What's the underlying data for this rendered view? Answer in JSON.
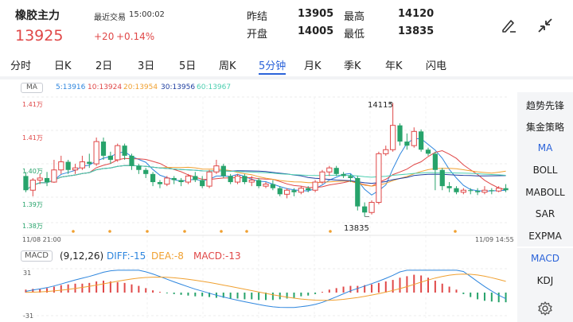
{
  "header": {
    "symbol": "橡胶主力",
    "last_trade_label": "最近交易",
    "last_trade_time": "15:00:02",
    "price": "13925",
    "change": "+20",
    "change_pct": "+0.14%",
    "prev_close_label": "昨结",
    "prev_close": "13905",
    "open_label": "开盘",
    "open": "14005",
    "high_label": "最高",
    "high": "14120",
    "low_label": "最低",
    "low": "13835",
    "icons": [
      "draw-pen-icon",
      "collapse-arrows-icon"
    ]
  },
  "tabs": [
    {
      "label": "分时"
    },
    {
      "label": "日K"
    },
    {
      "label": "2日"
    },
    {
      "label": "3日"
    },
    {
      "label": "5日"
    },
    {
      "label": "周K"
    },
    {
      "label": "5分钟",
      "active": true
    },
    {
      "label": "月K"
    },
    {
      "label": "季K"
    },
    {
      "label": "年K"
    },
    {
      "label": "闪电"
    }
  ],
  "ma_legend": {
    "badge": "MA",
    "items": [
      {
        "label": "5:13916",
        "color": "#2e86de"
      },
      {
        "label": "10:13924",
        "color": "#e04848"
      },
      {
        "label": "20:13954",
        "color": "#f0a030"
      },
      {
        "label": "30:13956",
        "color": "#1f3fa0"
      },
      {
        "label": "60:13967",
        "color": "#4ccfb0"
      }
    ]
  },
  "price_axis": {
    "labels": [
      "1.41万",
      "1.41万",
      "1.40万",
      "1.39万",
      "1.38万"
    ]
  },
  "time_axis": {
    "start": "11/08 21:00",
    "end": "11/09 14:55"
  },
  "markers": {
    "high": "14115",
    "low": "13835"
  },
  "macd_legend": {
    "badge": "MACD",
    "params": "(9,12,26)",
    "diff": "DIFF:-15",
    "dea": "DEA:-8",
    "macd": "MACD:-13",
    "axis_top": "31",
    "axis_bottom": "-31"
  },
  "sidebar": {
    "items": [
      {
        "label": "趋势先锋"
      },
      {
        "label": "集金策略"
      },
      {
        "label": "MA",
        "active": true
      },
      {
        "label": "BOLL"
      },
      {
        "label": "MABOLL"
      },
      {
        "label": "SAR"
      },
      {
        "label": "EXPMA"
      },
      {
        "label": "MACD",
        "active": true
      },
      {
        "label": "KDJ"
      }
    ],
    "settings_icon": "gear-icon"
  },
  "colors": {
    "up": "#e04848",
    "down": "#27a36b",
    "accent": "#2b63d9"
  },
  "chart_data": {
    "type": "candlestick",
    "y_range": [
      13820,
      14130
    ],
    "candles": [
      [
        13935,
        13900,
        13945,
        13895
      ],
      [
        13900,
        13925,
        13930,
        13885
      ],
      [
        13925,
        13930,
        13940,
        13915
      ],
      [
        13930,
        13920,
        13945,
        13910
      ],
      [
        13920,
        13950,
        13975,
        13918
      ],
      [
        13950,
        13970,
        13985,
        13940
      ],
      [
        13970,
        13950,
        13975,
        13940
      ],
      [
        13950,
        13955,
        13965,
        13940
      ],
      [
        13955,
        13970,
        13985,
        13950
      ],
      [
        13970,
        13965,
        13990,
        13955
      ],
      [
        13965,
        14020,
        14030,
        13960
      ],
      [
        14020,
        13985,
        14030,
        13975
      ],
      [
        13985,
        13975,
        13995,
        13965
      ],
      [
        13975,
        14010,
        14015,
        13970
      ],
      [
        14010,
        13985,
        14015,
        13975
      ],
      [
        13985,
        13960,
        13990,
        13950
      ],
      [
        13960,
        13950,
        13965,
        13940
      ],
      [
        13950,
        13940,
        13955,
        13930
      ],
      [
        13940,
        13920,
        13945,
        13910
      ],
      [
        13920,
        13915,
        13925,
        13905
      ],
      [
        13915,
        13930,
        13935,
        13910
      ],
      [
        13930,
        13925,
        13935,
        13915
      ],
      [
        13925,
        13920,
        13930,
        13910
      ],
      [
        13920,
        13935,
        13940,
        13915
      ],
      [
        13935,
        13925,
        13945,
        13920
      ],
      [
        13925,
        13910,
        13935,
        13905
      ],
      [
        13910,
        13945,
        13950,
        13905
      ],
      [
        13945,
        13960,
        13975,
        13940
      ],
      [
        13960,
        13935,
        13965,
        13930
      ],
      [
        13935,
        13920,
        13940,
        13915
      ],
      [
        13920,
        13935,
        13940,
        13915
      ],
      [
        13935,
        13920,
        13940,
        13915
      ],
      [
        13920,
        13925,
        13935,
        13910
      ],
      [
        13925,
        13910,
        13930,
        13905
      ],
      [
        13910,
        13915,
        13920,
        13905
      ],
      [
        13915,
        13905,
        13925,
        13900
      ],
      [
        13905,
        13890,
        13910,
        13885
      ],
      [
        13890,
        13900,
        13905,
        13880
      ],
      [
        13900,
        13895,
        13905,
        13885
      ],
      [
        13895,
        13905,
        13910,
        13890
      ],
      [
        13905,
        13900,
        13910,
        13895
      ],
      [
        13900,
        13920,
        13925,
        13895
      ],
      [
        13920,
        13945,
        13950,
        13915
      ],
      [
        13945,
        13955,
        13960,
        13935
      ],
      [
        13955,
        13940,
        13960,
        13935
      ],
      [
        13940,
        13935,
        13945,
        13930
      ],
      [
        13935,
        13930,
        13940,
        13920
      ],
      [
        13930,
        13860,
        13935,
        13850
      ],
      [
        13860,
        13845,
        13870,
        13835
      ],
      [
        13845,
        13870,
        13875,
        13840
      ],
      [
        13870,
        13990,
        13995,
        13865
      ],
      [
        13990,
        14000,
        14010,
        13985
      ],
      [
        14000,
        14060,
        14115,
        13995
      ],
      [
        14060,
        14020,
        14065,
        14010
      ],
      [
        14020,
        14010,
        14040,
        14000
      ],
      [
        14010,
        14045,
        14055,
        14005
      ],
      [
        14045,
        14000,
        14050,
        13995
      ],
      [
        14000,
        13990,
        14005,
        13985
      ],
      [
        13990,
        13950,
        13995,
        13900
      ],
      [
        13950,
        13910,
        13955,
        13900
      ],
      [
        13910,
        13905,
        13920,
        13895
      ],
      [
        13905,
        13895,
        13910,
        13890
      ],
      [
        13895,
        13900,
        13905,
        13890
      ],
      [
        13900,
        13898,
        13905,
        13890
      ],
      [
        13898,
        13895,
        13905,
        13888
      ],
      [
        13895,
        13900,
        13910,
        13890
      ],
      [
        13900,
        13898,
        13905,
        13890
      ],
      [
        13898,
        13905,
        13910,
        13895
      ],
      [
        13905,
        13900,
        13915,
        13895
      ]
    ],
    "macd_hist": [
      4,
      5,
      5,
      6,
      8,
      10,
      11,
      12,
      12,
      13,
      15,
      16,
      15,
      14,
      13,
      11,
      9,
      6,
      3,
      1,
      -1,
      -2,
      -3,
      -4,
      -5,
      -5,
      -6,
      -7,
      -7,
      -8,
      -8,
      -9,
      -9,
      -10,
      -10,
      -10,
      -9,
      -8,
      -7,
      -5,
      -4,
      -2,
      1,
      4,
      6,
      8,
      9,
      9,
      10,
      11,
      13,
      15,
      17,
      20,
      22,
      24,
      23,
      20,
      16,
      12,
      8,
      4,
      -2,
      -6,
      -9,
      -11,
      -12,
      -13,
      -13
    ]
  }
}
